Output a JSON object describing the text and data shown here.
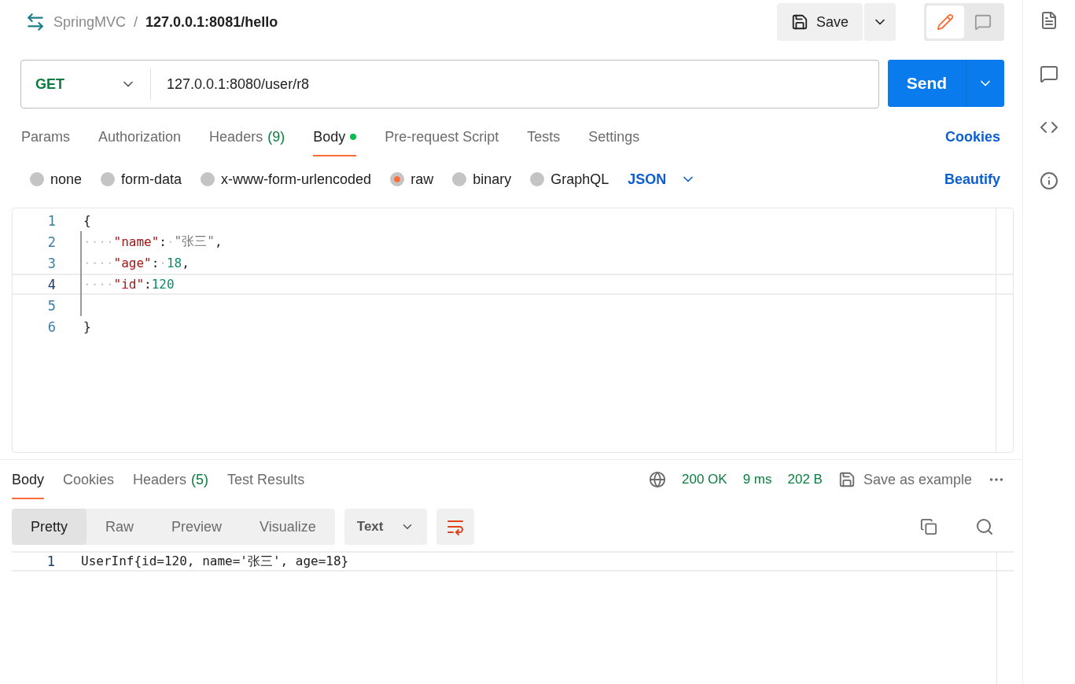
{
  "header": {
    "collection": "SpringMVC",
    "separator": "/",
    "request_name": "127.0.0.1:8081/hello",
    "save_label": "Save",
    "mode_toggle": [
      {
        "kind": "edit",
        "selected": true
      },
      {
        "kind": "comment",
        "selected": false
      }
    ]
  },
  "request": {
    "method": "GET",
    "url": "127.0.0.1:8080/user/r8",
    "send_label": "Send"
  },
  "request_tabs": [
    {
      "label": "Params",
      "selected": false
    },
    {
      "label": "Authorization",
      "selected": false
    },
    {
      "label": "Headers",
      "count": "(9)",
      "selected": false
    },
    {
      "label": "Body",
      "selected": true,
      "dot": true
    },
    {
      "label": "Pre-request Script",
      "selected": false
    },
    {
      "label": "Tests",
      "selected": false
    },
    {
      "label": "Settings",
      "selected": false
    }
  ],
  "cookies_link": "Cookies",
  "body_types": [
    {
      "label": "none",
      "selected": false
    },
    {
      "label": "form-data",
      "selected": false
    },
    {
      "label": "x-www-form-urlencoded",
      "selected": false
    },
    {
      "label": "raw",
      "selected": true
    },
    {
      "label": "binary",
      "selected": false
    },
    {
      "label": "GraphQL",
      "selected": false
    }
  ],
  "body_language": "JSON",
  "beautify": "Beautify",
  "editor": {
    "lines": [
      {
        "number": "1",
        "active": false,
        "guide": false,
        "tokens": [
          {
            "kind": "punct",
            "text": "{"
          }
        ]
      },
      {
        "number": "2",
        "active": false,
        "guide": true,
        "tokens": [
          {
            "kind": "ws",
            "text": "····"
          },
          {
            "kind": "key",
            "text": "\"name\""
          },
          {
            "kind": "punct",
            "text": ":"
          },
          {
            "kind": "ws",
            "text": "·"
          },
          {
            "kind": "string",
            "text": "\"张三\""
          },
          {
            "kind": "punct",
            "text": ","
          }
        ]
      },
      {
        "number": "3",
        "active": false,
        "guide": true,
        "tokens": [
          {
            "kind": "ws",
            "text": "····"
          },
          {
            "kind": "key",
            "text": "\"age\""
          },
          {
            "kind": "punct",
            "text": ":"
          },
          {
            "kind": "ws",
            "text": "·"
          },
          {
            "kind": "number",
            "text": "18"
          },
          {
            "kind": "punct",
            "text": ","
          }
        ]
      },
      {
        "number": "4",
        "active": true,
        "guide": true,
        "tokens": [
          {
            "kind": "ws",
            "text": "····"
          },
          {
            "kind": "key",
            "text": "\"id\""
          },
          {
            "kind": "punct",
            "text": ":"
          },
          {
            "kind": "number",
            "text": "120"
          }
        ]
      },
      {
        "number": "5",
        "active": false,
        "guide": true
      },
      {
        "number": "6",
        "active": false,
        "guide": false,
        "tokens": [
          {
            "kind": "punct",
            "text": "}"
          }
        ]
      }
    ]
  },
  "response": {
    "tabs": [
      {
        "label": "Body",
        "selected": true
      },
      {
        "label": "Cookies",
        "selected": false
      },
      {
        "label": "Headers",
        "count": "(5)",
        "selected": false
      },
      {
        "label": "Test Results",
        "selected": false
      }
    ],
    "status": "200 OK",
    "time": "9 ms",
    "size": "202 B",
    "save_example": "Save as example",
    "views": [
      {
        "label": "Pretty",
        "selected": true
      },
      {
        "label": "Raw",
        "selected": false
      },
      {
        "label": "Preview",
        "selected": false
      },
      {
        "label": "Visualize",
        "selected": false
      }
    ],
    "format": "Text",
    "lines": [
      {
        "number": "1",
        "active": true,
        "text": "UserInf{id=120, name='张三', age=18}"
      }
    ]
  }
}
